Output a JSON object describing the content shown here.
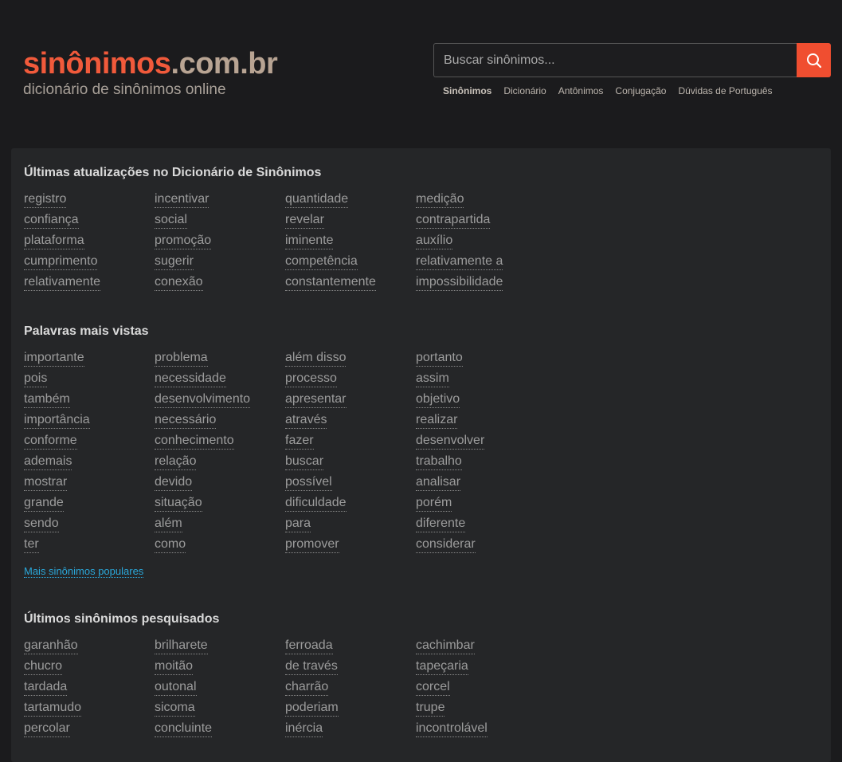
{
  "logo": {
    "part1": "sinônimos",
    "part2": ".com.br",
    "tagline": "dicionário de sinônimos online"
  },
  "search": {
    "placeholder": "Buscar sinônimos...",
    "icon": "search-icon"
  },
  "nav": [
    "Sinônimos",
    "Dicionário",
    "Antônimos",
    "Conjugação",
    "Dúvidas de Português"
  ],
  "sections": {
    "updates": {
      "title": "Últimas atualizações no Dicionário de Sinônimos",
      "words": [
        "registro",
        "incentivar",
        "quantidade",
        "medição",
        "confiança",
        "social",
        "revelar",
        "contrapartida",
        "plataforma",
        "promoção",
        "iminente",
        "auxílio",
        "cumprimento",
        "sugerir",
        "competência",
        "relativamente a",
        "relativamente",
        "conexão",
        "constantemente",
        "impossibilidade"
      ]
    },
    "most_viewed": {
      "title": "Palavras mais vistas",
      "words": [
        "importante",
        "problema",
        "além disso",
        "portanto",
        "pois",
        "necessidade",
        "processo",
        "assim",
        "também",
        "desenvolvimento",
        "apresentar",
        "objetivo",
        "importância",
        "necessário",
        "através",
        "realizar",
        "conforme",
        "conhecimento",
        "fazer",
        "desenvolver",
        "ademais",
        "relação",
        "buscar",
        "trabalho",
        "mostrar",
        "devido",
        "possível",
        "analisar",
        "grande",
        "situação",
        "dificuldade",
        "porém",
        "sendo",
        "além",
        "para",
        "diferente",
        "ter",
        "como",
        "promover",
        "considerar"
      ],
      "more_link": "Mais sinônimos populares"
    },
    "recent": {
      "title": "Últimos sinônimos pesquisados",
      "words": [
        "garanhão",
        "brilharete",
        "ferroada",
        "cachimbar",
        "chucro",
        "moitão",
        "de través",
        "tapeçaria",
        "tardada",
        "outonal",
        "charrão",
        "corcel",
        "tartamudo",
        "sicoma",
        "poderiam",
        "trupe",
        "percolar",
        "concluinte",
        "inércia",
        "incontrolável"
      ]
    }
  },
  "colors": {
    "accent": "#f15a3b",
    "logo_secondary": "#b8a493",
    "link_blue": "#2aa6d8",
    "background": "#1b1b1d",
    "panel": "#252628"
  }
}
